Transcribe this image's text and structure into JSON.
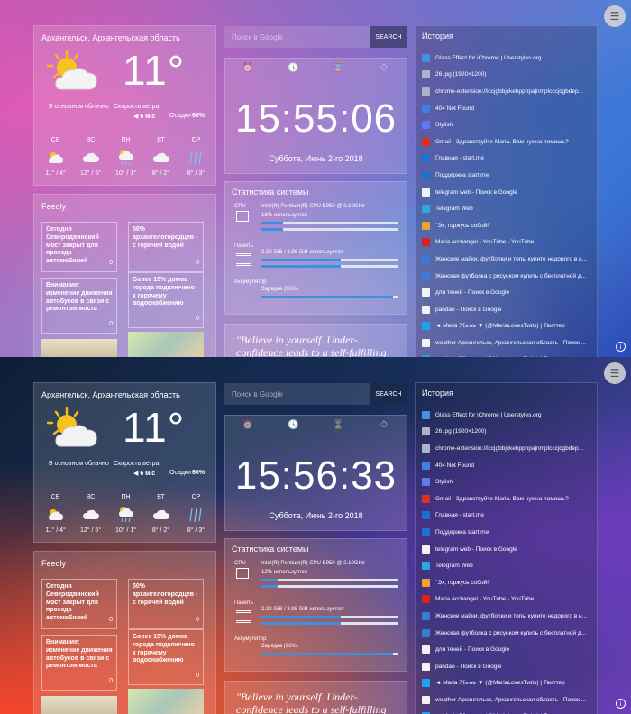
{
  "screens": [
    {
      "weather": {
        "location": "Архангельск, Архангельская область",
        "temp": "11°",
        "desc": "В основном облачно",
        "wind_label": "Скорость ветра",
        "wind_value": "6 м/с",
        "humidity_label": "Осадки",
        "humidity_value": "60%",
        "days": [
          {
            "name": "СБ",
            "temps": "11° / 4°",
            "icon": "partly-cloudy-icon"
          },
          {
            "name": "ВС",
            "temps": "12° / 5°",
            "icon": "cloud-icon"
          },
          {
            "name": "ПН",
            "temps": "10° / 1°",
            "icon": "rain-sun-icon"
          },
          {
            "name": "ВТ",
            "temps": "8° / 2°",
            "icon": "cloud-icon"
          },
          {
            "name": "СР",
            "temps": "8° / 3°",
            "icon": "rain-icon"
          }
        ]
      },
      "feedly": {
        "title": "Feedly",
        "cards": [
          {
            "text": "Сегодня Северодвинский мост закрыт для проезда автомобилей",
            "count": "0"
          },
          {
            "text": "50% архангелогородцев - с горячей водой",
            "count": "0"
          },
          {
            "text": "Внимание: изменение движения автобусов в связи с ремонтом моста",
            "count": "0"
          },
          {
            "text": "Более 15% домов города подключено к горячему водоснабжению",
            "count": "0"
          }
        ]
      },
      "search": {
        "placeholder": "Поиск в Google",
        "button": "SEARCH"
      },
      "clock": {
        "time": "15:55:06",
        "date": "Суббота, Июнь 2-го 2018"
      },
      "stats": {
        "title": "Статистика системы",
        "cpu_label": "CPU",
        "cpu_name": "Intel(R) Pentium(R) CPU B950 @ 2.10GHz",
        "cpu_usage": "16% используется",
        "cpu_fraction": 0.16,
        "mem_label": "Память",
        "mem_text": "2.32 GiB / 3.98 GiB используется",
        "mem_fraction": 0.58,
        "bat_label": "Аккумулятор",
        "bat_text": "Зарядка (96%)",
        "bat_fraction": 0.96
      },
      "quote": "\"Believe in yourself. Under-confidence leads to a self-fulfilling prophecy that",
      "history": {
        "title": "История",
        "items": [
          {
            "text": "Glass Effect for iChrome | Userstyles.org",
            "color": "#4a8fe7"
          },
          {
            "text": "26.jpg (1920×1200)",
            "color": "#a9b3c9"
          },
          {
            "text": "chrome-extension://iccjgbbjckehppnpajnmplcccjcgbdep...",
            "color": "#a9b3c9"
          },
          {
            "text": "404 Not Found",
            "color": "#3b82e6"
          },
          {
            "text": "Stylish",
            "color": "#5b7cf0"
          },
          {
            "text": "Gmail - Здравствуйте Maria. Вам нужна помощь?",
            "color": "#d93025"
          },
          {
            "text": "Главная - start.me",
            "color": "#1f6fd1"
          },
          {
            "text": "Поддержка start.me",
            "color": "#1f6fd1"
          },
          {
            "text": "telegram web - Поиск в Google",
            "color": "#f2f2f2"
          },
          {
            "text": "Telegram Web",
            "color": "#2ea6e0"
          },
          {
            "text": "\"Эх, горжусь собой!\"",
            "color": "#f0a030"
          },
          {
            "text": "Maria Archangel - YouTube - YouTube",
            "color": "#e02020"
          },
          {
            "text": "Женские майки, футболки и топы купите недорого в и...",
            "color": "#3a7bd5"
          },
          {
            "text": "Женская футболка с рисунком купить с бесплатной д...",
            "color": "#3a7bd5"
          },
          {
            "text": "для теней - Поиск в Google",
            "color": "#f2f2f2"
          },
          {
            "text": "pandao - Поиск в Google",
            "color": "#f2f2f2"
          },
          {
            "text": "◄ Maria ℳ𝒶𝓇𝒾𝒶 ▼ (@MariaLovesTwits) | Твиттер",
            "color": "#1da1f2"
          },
          {
            "text": "weather Архангельск, Архангельская область - Поиск ...",
            "color": "#f2f2f2"
          },
          {
            "text": "◄ Maria ℳ𝒶𝓇𝒾𝒶 ▼ (@MariaLovesTwits) | Твиттер",
            "color": "#1da1f2"
          }
        ]
      }
    },
    {
      "weather": {
        "location": "Архангельск, Архангельская область",
        "temp": "11°",
        "desc": "В основном облачно",
        "wind_label": "Скорость ветра",
        "wind_value": "6 м/с",
        "humidity_label": "Осадки",
        "humidity_value": "60%",
        "days": [
          {
            "name": "СБ",
            "temps": "11° / 4°",
            "icon": "partly-cloudy-icon"
          },
          {
            "name": "ВС",
            "temps": "12° / 5°",
            "icon": "cloud-icon"
          },
          {
            "name": "ПН",
            "temps": "10° / 1°",
            "icon": "rain-sun-icon"
          },
          {
            "name": "ВТ",
            "temps": "8° / 2°",
            "icon": "cloud-icon"
          },
          {
            "name": "СР",
            "temps": "8° / 3°",
            "icon": "rain-icon"
          }
        ]
      },
      "feedly": {
        "title": "Feedly",
        "cards": [
          {
            "text": "Сегодня Северодвинский мост закрыт для проезда автомобилей",
            "count": "0"
          },
          {
            "text": "50% архангелогородцев - с горячей водой",
            "count": "0"
          },
          {
            "text": "Внимание: изменение движения автобусов в связи с ремонтом моста",
            "count": "0"
          },
          {
            "text": "Более 15% домов города подключено к горячему водоснабжению",
            "count": "0"
          }
        ]
      },
      "search": {
        "placeholder": "Поиск в Google",
        "button": "SEARCH"
      },
      "clock": {
        "time": "15:56:33",
        "date": "Суббота, Июнь 2-го 2018"
      },
      "stats": {
        "title": "Статистика системы",
        "cpu_label": "CPU",
        "cpu_name": "Intel(R) Pentium(R) CPU B950 @ 2.10GHz",
        "cpu_usage": "12% используется",
        "cpu_fraction": 0.12,
        "mem_label": "Память",
        "mem_text": "2.32 GiB / 3.98 GiB используется",
        "mem_fraction": 0.58,
        "bat_label": "Аккумулятор",
        "bat_text": "Зарядка (96%)",
        "bat_fraction": 0.96
      },
      "quote": "\"Believe in yourself. Under-confidence leads to a self-fulfilling prophecy that",
      "history": {
        "title": "История",
        "items": [
          {
            "text": "Glass Effect for iChrome | Userstyles.org",
            "color": "#4a8fe7"
          },
          {
            "text": "26.jpg (1920×1200)",
            "color": "#a9b3c9"
          },
          {
            "text": "chrome-extension://iccjgbbjckehppnpajnmplcccjcgbdep...",
            "color": "#a9b3c9"
          },
          {
            "text": "404 Not Found",
            "color": "#3b82e6"
          },
          {
            "text": "Stylish",
            "color": "#5b7cf0"
          },
          {
            "text": "Gmail - Здравствуйте Maria. Вам нужна помощь?",
            "color": "#d93025"
          },
          {
            "text": "Главная - start.me",
            "color": "#1f6fd1"
          },
          {
            "text": "Поддержка start.me",
            "color": "#1f6fd1"
          },
          {
            "text": "telegram web - Поиск в Google",
            "color": "#f2f2f2"
          },
          {
            "text": "Telegram Web",
            "color": "#2ea6e0"
          },
          {
            "text": "\"Эх, горжусь собой!\"",
            "color": "#f0a030"
          },
          {
            "text": "Maria Archangel - YouTube - YouTube",
            "color": "#e02020"
          },
          {
            "text": "Женские майки, футболки и топы купите недорого в и...",
            "color": "#3a7bd5"
          },
          {
            "text": "Женская футболка с рисунком купить с бесплатной д...",
            "color": "#3a7bd5"
          },
          {
            "text": "для теней - Поиск в Google",
            "color": "#f2f2f2"
          },
          {
            "text": "pandao - Поиск в Google",
            "color": "#f2f2f2"
          },
          {
            "text": "◄ Maria ℳ𝒶𝓇𝒾𝒶 ▼ (@MariaLovesTwits) | Твиттер",
            "color": "#1da1f2"
          },
          {
            "text": "weather Архангельск, Архангельская область - Поиск ...",
            "color": "#f2f2f2"
          },
          {
            "text": "◄ Maria ℳ𝒶𝓇𝒾𝒶 ▼ (@MariaLovesTwits) | Твиттер",
            "color": "#1da1f2"
          }
        ]
      }
    }
  ]
}
